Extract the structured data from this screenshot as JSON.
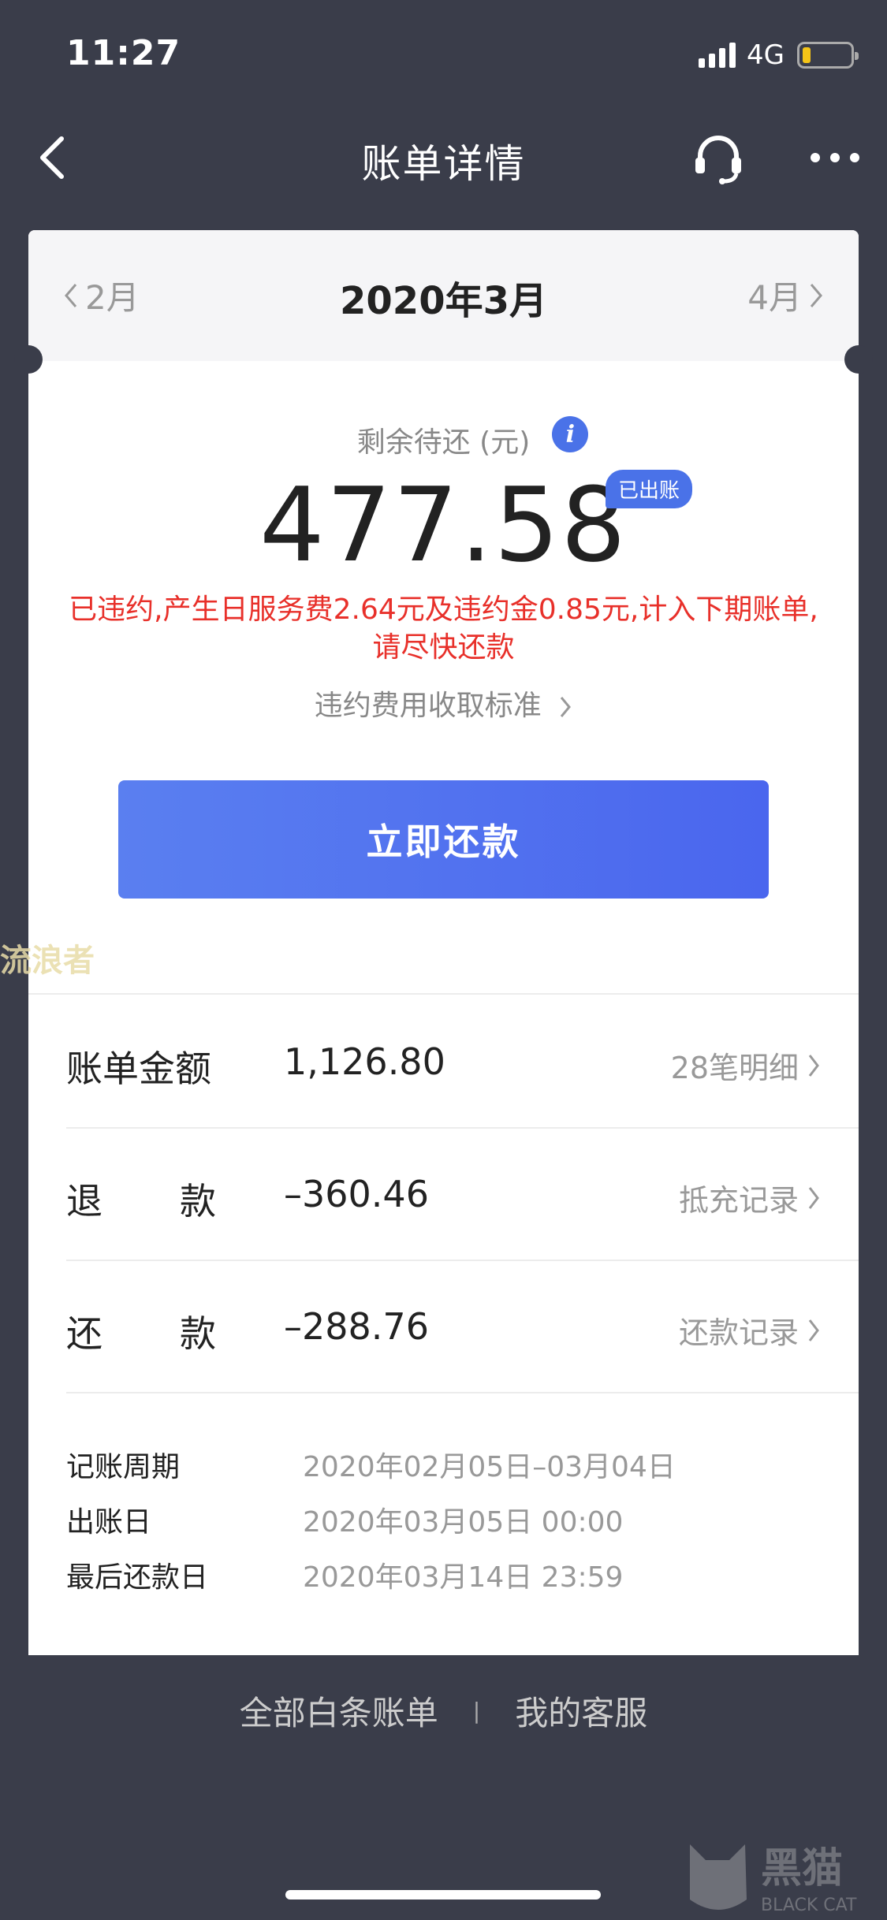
{
  "status": {
    "time": "11:27",
    "network": "4G"
  },
  "nav": {
    "title": "账单详情"
  },
  "month": {
    "prev": "2月",
    "current": "2020年3月",
    "next": "4月"
  },
  "summary": {
    "label": "剩余待还 (元)",
    "amount": "477.58",
    "badge": "已出账",
    "warning_line1": "已违约,产生日服务费2.64元及违约金0.85元,计入下期账单,",
    "warning_line2": "请尽快还款",
    "fee_link": "违约费用收取标准",
    "pay_button": "立即还款"
  },
  "rows": [
    {
      "label_a": "账单金额",
      "label_b": "",
      "value": "1,126.80",
      "link": "28笔明细"
    },
    {
      "label_a": "退",
      "label_b": "款",
      "value": "–360.46",
      "link": "抵充记录"
    },
    {
      "label_a": "还",
      "label_b": "款",
      "value": "–288.76",
      "link": "还款记录"
    }
  ],
  "details": [
    {
      "key": "记账周期",
      "value": "2020年02月05日–03月04日"
    },
    {
      "key": "出账日",
      "value": "2020年03月05日 00:00"
    },
    {
      "key": "最后还款日",
      "value": "2020年03月14日 23:59"
    }
  ],
  "bottom": {
    "all_bills": "全部白条账单",
    "separator": "|",
    "customer_service": "我的客服"
  },
  "watermark": "流浪者",
  "corner_logo": {
    "cn": "黑猫",
    "en": "BLACK CAT"
  },
  "colors": {
    "accent": "#4a72e8",
    "warning": "#e8302a",
    "background": "#3a3d4a"
  }
}
